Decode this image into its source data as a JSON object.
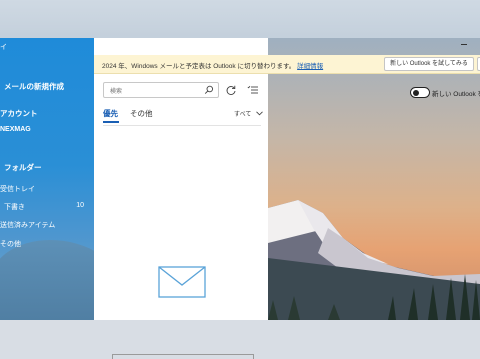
{
  "nav": {
    "inbox_title": "イ",
    "new_mail": "メールの新規作成",
    "accounts": "アカウント",
    "account_name": "NEXMAG",
    "folders": "フォルダー",
    "items": [
      {
        "label": "受信トレイ",
        "count": ""
      },
      {
        "label": "下書き",
        "count": "10"
      },
      {
        "label": "送信済みアイテム",
        "count": ""
      },
      {
        "label": "その他",
        "count": ""
      }
    ]
  },
  "list": {
    "search_placeholder": "検索",
    "tab_focused": "優先",
    "tab_other": "その他",
    "filter": "すべて"
  },
  "infobar": {
    "message": "2024 年、Windows メールと予定表は Outlook に切り替わります。",
    "link": "詳細情報",
    "button": "新しい Outlook を試してみる"
  },
  "toggle": {
    "label": "新しい Outlook を"
  },
  "colors": {
    "accent": "#1a5fb4",
    "nav_blue": "#1f8bd9",
    "infobar": "#fdf4d3"
  }
}
